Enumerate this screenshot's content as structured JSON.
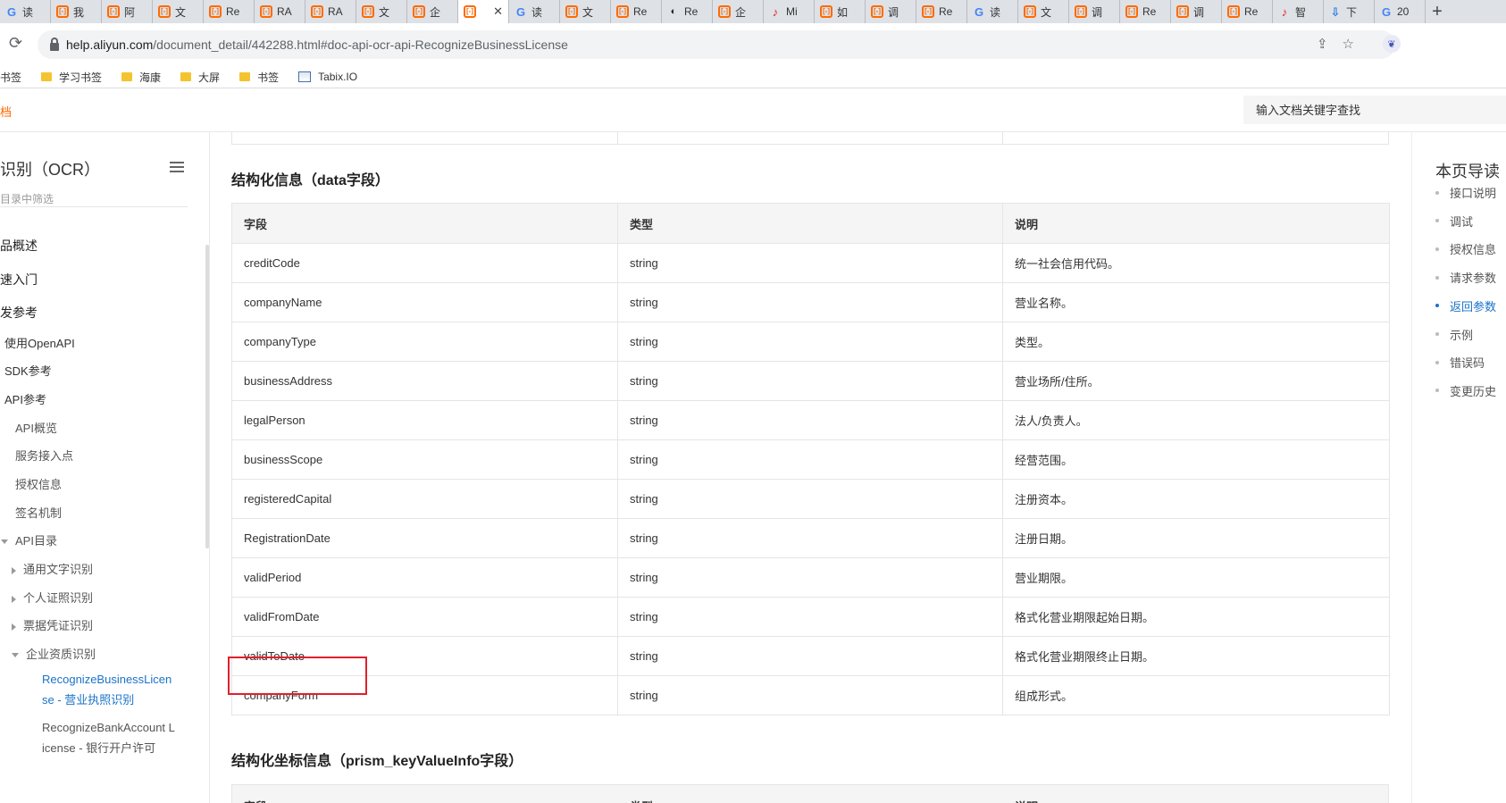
{
  "browser": {
    "tabs": [
      {
        "icon": "g",
        "label": "读"
      },
      {
        "icon": "ali",
        "label": "我"
      },
      {
        "icon": "ali",
        "label": "阿"
      },
      {
        "icon": "ali",
        "label": "文"
      },
      {
        "icon": "ali",
        "label": "Re"
      },
      {
        "icon": "ali",
        "label": "RA"
      },
      {
        "icon": "ali",
        "label": "RA"
      },
      {
        "icon": "ali",
        "label": "文"
      },
      {
        "icon": "ali",
        "label": "企"
      },
      {
        "icon": "ali",
        "label": "",
        "active": true
      },
      {
        "icon": "g",
        "label": "读"
      },
      {
        "icon": "ali",
        "label": "文"
      },
      {
        "icon": "ali",
        "label": "Re"
      },
      {
        "icon": "xd",
        "label": "Re"
      },
      {
        "icon": "ali",
        "label": "企"
      },
      {
        "icon": "red",
        "label": "Mi"
      },
      {
        "icon": "ali",
        "label": "如"
      },
      {
        "icon": "ali",
        "label": "调"
      },
      {
        "icon": "ali",
        "label": "Re"
      },
      {
        "icon": "g",
        "label": "读"
      },
      {
        "icon": "ali",
        "label": "文"
      },
      {
        "icon": "ali",
        "label": "调"
      },
      {
        "icon": "ali",
        "label": "Re"
      },
      {
        "icon": "ali",
        "label": "调"
      },
      {
        "icon": "ali",
        "label": "Re"
      },
      {
        "icon": "red",
        "label": "智"
      },
      {
        "icon": "dl",
        "label": "下"
      },
      {
        "icon": "g",
        "label": "20"
      }
    ],
    "close_glyph": "✕",
    "newtab_glyph": "+",
    "url_host": "help.aliyun.com",
    "url_path": "/document_detail/442288.html#doc-api-ocr-api-RecognizeBusinessLicense",
    "bookmarks": [
      "书签",
      "学习书签",
      "海康",
      "大屏",
      "书签",
      "Tabix.IO"
    ]
  },
  "site": {
    "brand": "档",
    "search_placeholder": "输入文档关键字查找"
  },
  "sidebar": {
    "title": "识别（OCR）",
    "filter_placeholder": "目录中筛选",
    "items": [
      {
        "label": "品概述"
      },
      {
        "label": "速入门"
      },
      {
        "label": "发参考"
      },
      {
        "label": "使用OpenAPI"
      },
      {
        "label": "SDK参考"
      },
      {
        "label": "API参考"
      },
      {
        "label": "API概览"
      },
      {
        "label": "服务接入点"
      },
      {
        "label": "授权信息"
      },
      {
        "label": "签名机制"
      },
      {
        "label": "API目录"
      },
      {
        "label": "通用文字识别"
      },
      {
        "label": "个人证照识别"
      },
      {
        "label": "票据凭证识别"
      },
      {
        "label": "企业资质识别"
      },
      {
        "label": "RecognizeBusinessLicense - 营业执照识别"
      },
      {
        "label": "RecognizeBankAccount License - 银行开户许可"
      }
    ]
  },
  "content": {
    "section_title": "结构化信息（data字段）",
    "headers": [
      "字段",
      "类型",
      "说明"
    ],
    "rows": [
      {
        "field": "creditCode",
        "type": "string",
        "desc": "统一社会信用代码。"
      },
      {
        "field": "companyName",
        "type": "string",
        "desc": "营业名称。"
      },
      {
        "field": "companyType",
        "type": "string",
        "desc": "类型。"
      },
      {
        "field": "businessAddress",
        "type": "string",
        "desc": "营业场所/住所。"
      },
      {
        "field": "legalPerson",
        "type": "string",
        "desc": "法人/负责人。"
      },
      {
        "field": "businessScope",
        "type": "string",
        "desc": "经营范围。"
      },
      {
        "field": "registeredCapital",
        "type": "string",
        "desc": "注册资本。"
      },
      {
        "field": "RegistrationDate",
        "type": "string",
        "desc": "注册日期。"
      },
      {
        "field": "validPeriod",
        "type": "string",
        "desc": "营业期限。"
      },
      {
        "field": "validFromDate",
        "type": "string",
        "desc": "格式化营业期限起始日期。"
      },
      {
        "field": "validToDate",
        "type": "string",
        "desc": "格式化营业期限终止日期。"
      },
      {
        "field": "companyForm",
        "type": "string",
        "desc": "组成形式。"
      }
    ],
    "section2_title": "结构化坐标信息（prism_keyValueInfo字段）",
    "section2_headers": [
      "字段",
      "类型",
      "说明"
    ]
  },
  "toc": {
    "title": "本页导读",
    "items": [
      {
        "label": "接口说明"
      },
      {
        "label": "调试"
      },
      {
        "label": "授权信息"
      },
      {
        "label": "请求参数"
      },
      {
        "label": "返回参数",
        "active": true
      },
      {
        "label": "示例"
      },
      {
        "label": "错误码"
      },
      {
        "label": "变更历史"
      }
    ]
  }
}
